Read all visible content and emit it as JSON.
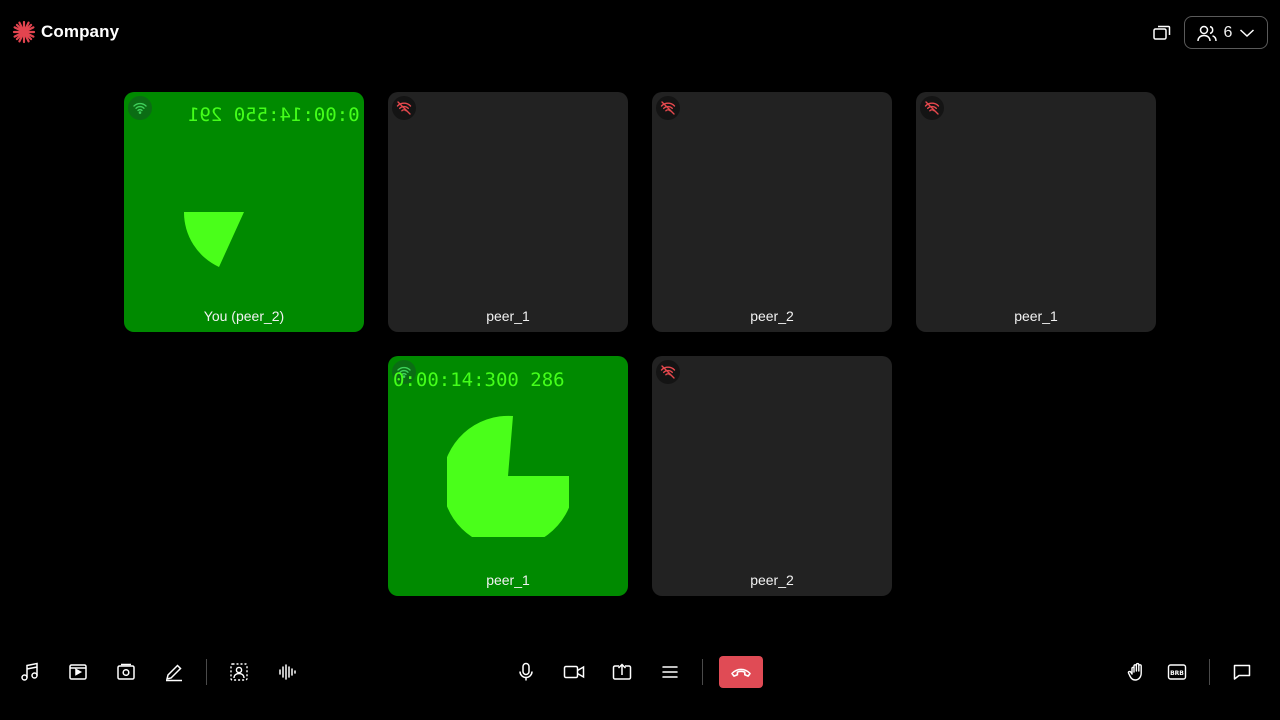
{
  "header": {
    "brand_name": "Company",
    "participant_count": "6",
    "accent_color": "#e2444f"
  },
  "tiles": [
    {
      "name": "You (peer_2)",
      "video": true,
      "timer": "0:00:14:550 291",
      "timer_mirrored": true,
      "network": "good",
      "pie_fraction": 0.13
    },
    {
      "name": "peer_1",
      "video": false,
      "network": "poor"
    },
    {
      "name": "peer_2",
      "video": false,
      "network": "poor"
    },
    {
      "name": "peer_1",
      "video": false,
      "network": "poor"
    },
    {
      "name": "peer_1",
      "video": true,
      "timer": "0:00:14:300 286",
      "timer_mirrored": false,
      "network": "good",
      "pie_fraction": 0.76
    },
    {
      "name": "peer_2",
      "video": false,
      "network": "poor"
    }
  ],
  "toolbar": {
    "left_icons": [
      "music-icon",
      "video-playlist-icon",
      "image-icon",
      "pencil-icon",
      "virtual-background-icon",
      "noise-cancel-icon"
    ],
    "center_icons": [
      "microphone-icon",
      "camera-icon",
      "screen-share-icon",
      "menu-icon",
      "leave-call-icon"
    ],
    "right_icons": [
      "raise-hand-icon",
      "brb-icon",
      "chat-icon"
    ],
    "leave_color": "#e04b55"
  },
  "colors": {
    "tile_bg": "#222222",
    "video_bg": "#008a00",
    "timer_color": "#44ff1a",
    "network_poor": "#e5484d",
    "network_good": "#3ecf5a"
  }
}
